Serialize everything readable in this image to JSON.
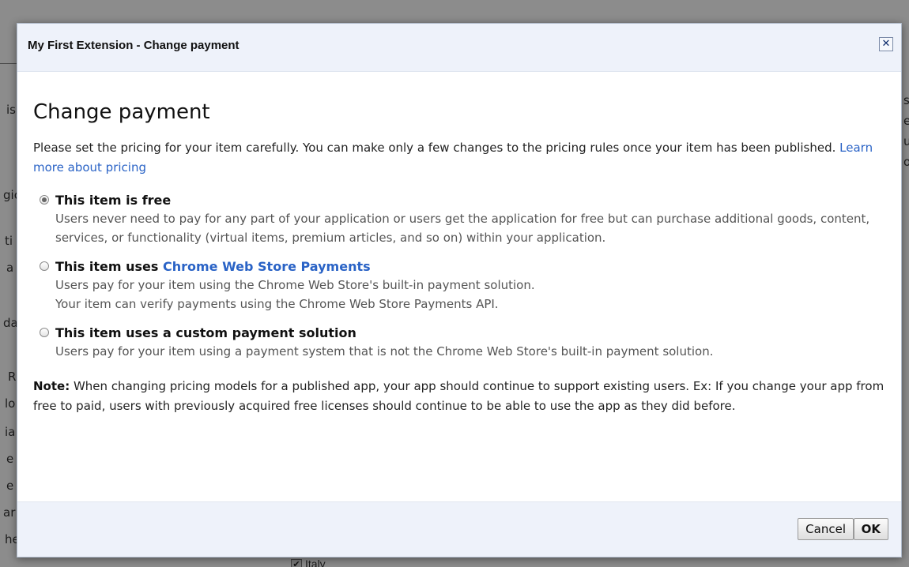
{
  "background": {
    "fragments": [
      "is",
      "gic",
      "ti",
      "a",
      "da",
      "R",
      "lo",
      "ia",
      "e",
      "e",
      "ar",
      "he"
    ],
    "right_fragments": [
      "s",
      "e",
      "u",
      "o"
    ],
    "checkbox_label": "Italy"
  },
  "dialog": {
    "title": "My First Extension - Change payment",
    "close_label": "✕",
    "heading": "Change payment",
    "intro_text": "Please set the pricing for your item carefully. You can make only a few changes to the pricing rules once your item has been published.",
    "intro_link": "Learn more about pricing",
    "options": [
      {
        "title": "This item is free",
        "title_link": "",
        "checked": true,
        "desc_lines": [
          "Users never need to pay for any part of your application or users get the application for free but can purchase additional goods, content, services, or functionality (virtual items, premium articles, and so on) within your application."
        ]
      },
      {
        "title": "This item uses ",
        "title_link": "Chrome Web Store Payments",
        "checked": false,
        "desc_lines": [
          "Users pay for your item using the Chrome Web Store's built-in payment solution.",
          "Your item can verify payments using the Chrome Web Store Payments API."
        ]
      },
      {
        "title": "This item uses a custom payment solution",
        "title_link": "",
        "checked": false,
        "desc_lines": [
          "Users pay for your item using a payment system that is not the Chrome Web Store's built-in payment solution."
        ]
      }
    ],
    "note_label": "Note:",
    "note_text": " When changing pricing models for a published app, your app should continue to support existing users. Ex: If you change your app from free to paid, users with previously acquired free licenses should continue to be able to use the app as they did before.",
    "buttons": {
      "cancel": "Cancel",
      "ok": "OK"
    }
  }
}
